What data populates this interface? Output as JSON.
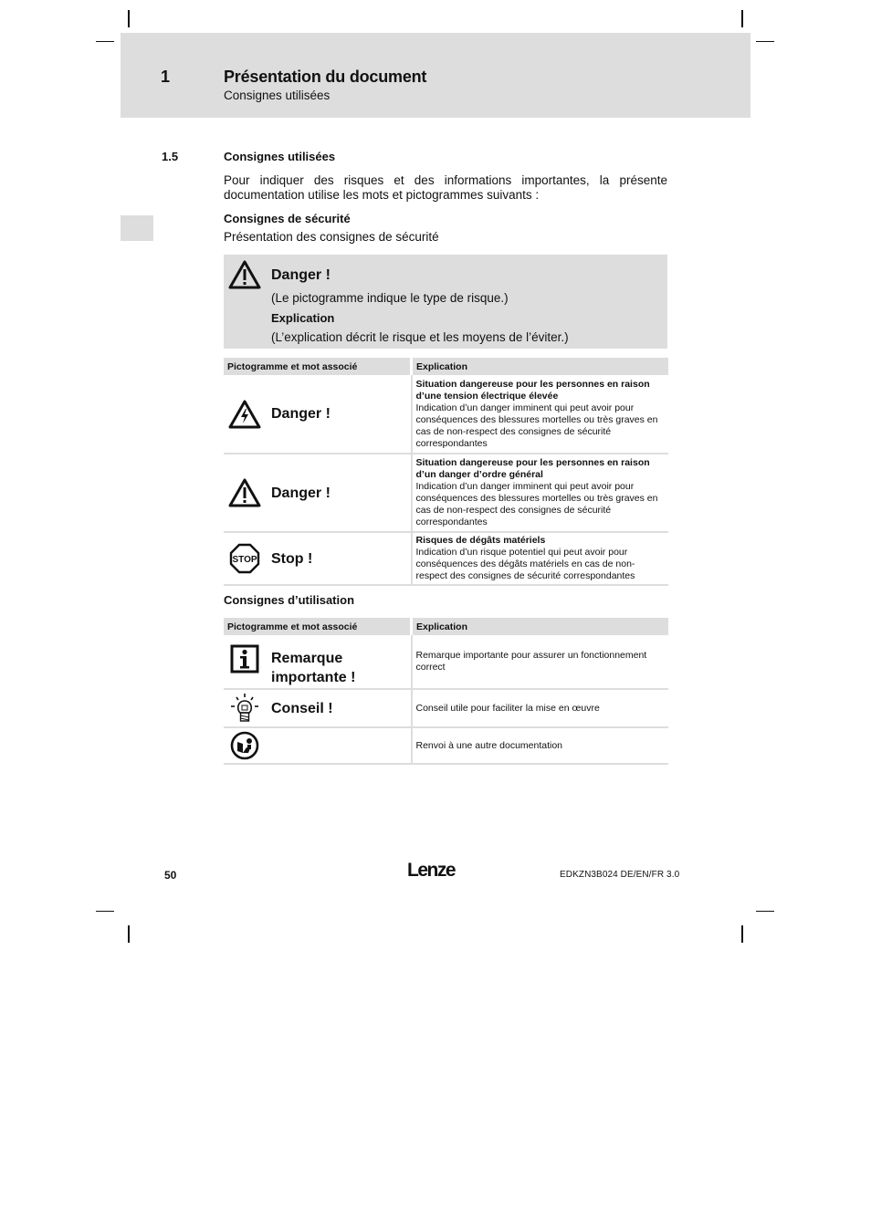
{
  "header": {
    "chapter_number": "1",
    "chapter_title": "Présentation du document",
    "chapter_subtitle": "Consignes utilisées"
  },
  "section": {
    "number": "1.5",
    "title": "Consignes utilisées",
    "intro": "Pour indiquer des risques et des informations importantes, la présente documentation utilise les mots et pictogrammes suivants :"
  },
  "safety": {
    "heading": "Consignes de sécurité",
    "subheading": "Présentation des consignes de sécurité",
    "box": {
      "icon": "warning-triangle-icon",
      "title": "Danger !",
      "pictogram_note": "(Le pictogramme indique le type de risque.)",
      "explication_label": "Explication",
      "explication_note": "(L’explication décrit le risque et les moyens de l’éviter.)"
    },
    "table": {
      "headers": [
        "Pictogramme et mot associé",
        "Explication"
      ],
      "rows": [
        {
          "icon": "electric-hazard-icon",
          "word": "Danger !",
          "title": "Situation dangereuse pour les personnes en raison d’une tension électrique élevée",
          "text": "Indication d’un danger imminent qui peut avoir pour conséquences des blessures mortelles ou très graves en cas de non-respect des consignes de sécurité correspondantes"
        },
        {
          "icon": "general-danger-icon",
          "word": "Danger !",
          "title": "Situation dangereuse pour les personnes en raison d’un danger d’ordre général",
          "text": "Indication d’un danger imminent qui peut avoir pour conséquences des blessures mortelles ou très graves en cas de non-respect des consignes de sécurité correspondantes"
        },
        {
          "icon": "stop-sign-icon",
          "icon_text": "STOP",
          "word": "Stop !",
          "title": "Risques de dégâts matériels",
          "text": "Indication d’un risque potentiel qui peut avoir pour conséquences des dégâts matériels en cas de non-respect des consignes de sécurité correspondantes"
        }
      ]
    }
  },
  "usage": {
    "heading": "Consignes d’utilisation",
    "table": {
      "headers": [
        "Pictogramme et mot associé",
        "Explication"
      ],
      "rows": [
        {
          "icon": "info-icon",
          "word": "Remarque importante !",
          "text": "Remarque importante pour assurer un fonctionnement correct"
        },
        {
          "icon": "lightbulb-icon",
          "word": "Conseil !",
          "text": "Conseil utile pour faciliter la mise en œuvre"
        },
        {
          "icon": "reference-book-icon",
          "word": "",
          "text": "Renvoi à une autre documentation"
        }
      ]
    }
  },
  "footer": {
    "page_number": "50",
    "logo": "Lenze",
    "doc_id": "EDKZN3B024  DE/EN/FR  3.0"
  }
}
